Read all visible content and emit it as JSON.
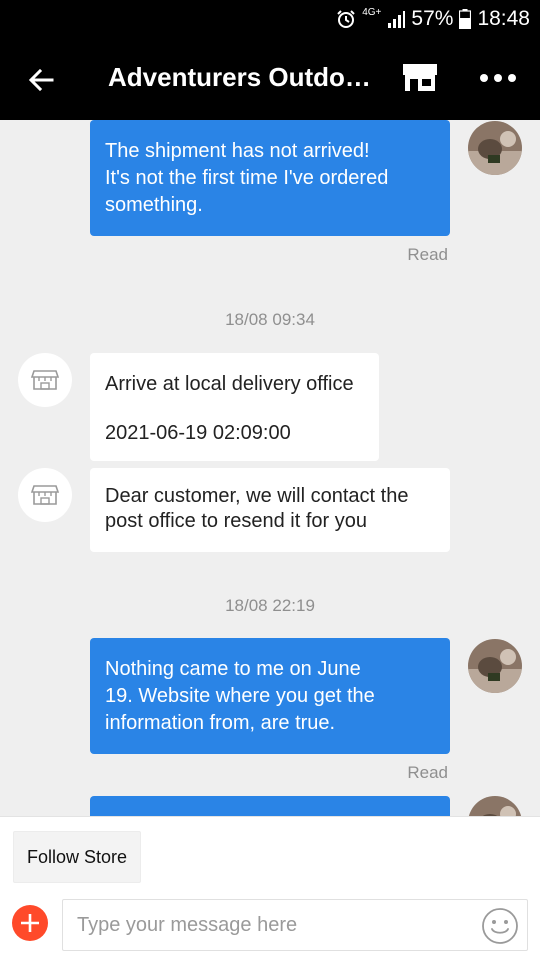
{
  "status_bar": {
    "network": "4G+",
    "battery": "57%",
    "time": "18:48",
    "icons": [
      "alarm-icon",
      "signal-icon",
      "battery-icon"
    ]
  },
  "app_bar": {
    "title": "Adventurers Outdoo…",
    "icons": [
      "back-arrow-icon",
      "store-icon",
      "more-icon"
    ]
  },
  "messages": {
    "m1": {
      "lines": [
        "The shipment has not arrived!",
        "It's not the first time I've ordered",
        "something."
      ],
      "status": "Read"
    },
    "time1": "18/08 09:34",
    "m2": {
      "line1": "Arrive at local delivery office",
      "line2": "2021-06-19 02:09:00"
    },
    "m3": {
      "lines": [
        "Dear customer, we will contact the",
        "post office to resend it for you"
      ]
    },
    "time2": "18/08 22:19",
    "m4": {
      "lines": [
        "Nothing came to me on June",
        "19. Website where you get the",
        "information from, are true."
      ],
      "status": "Read"
    }
  },
  "bottom": {
    "follow_label": "Follow Store",
    "input_placeholder": "Type your message here",
    "input_value": "",
    "icons": [
      "plus-icon",
      "emoji-icon"
    ]
  },
  "colors": {
    "my_bubble": "#2a84e6",
    "their_bubble": "#ffffff",
    "background": "#efefef",
    "accent": "#ff4a2a"
  }
}
